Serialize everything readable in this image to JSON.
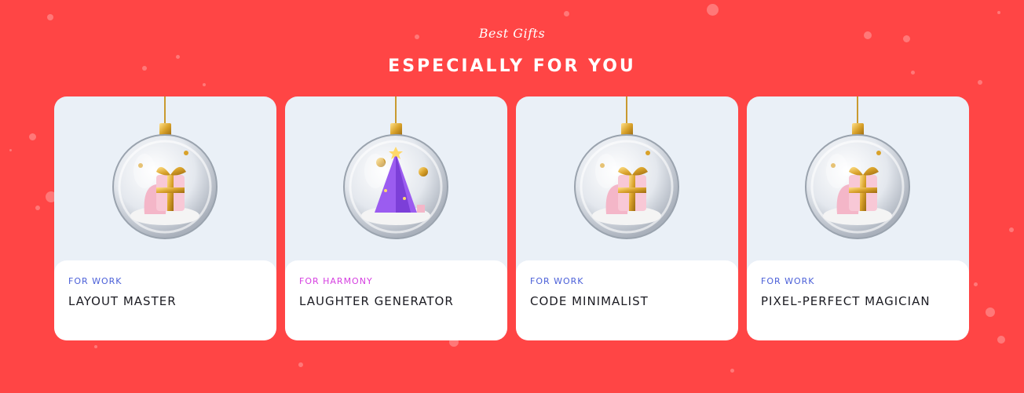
{
  "header": {
    "subtitle": "Best Gifts",
    "title": "ESPECIALLY FOR YOU"
  },
  "colors": {
    "background": "#ff4545",
    "card_bg": "#eaf0f7",
    "tag_work": "#4a5fd8",
    "tag_harmony": "#d53ee0"
  },
  "cards": [
    {
      "tag": "FOR WORK",
      "tag_color": "#4a5fd8",
      "name": "LAYOUT MASTER",
      "ornament": "gift-ornament"
    },
    {
      "tag": "FOR HARMONY",
      "tag_color": "#d53ee0",
      "name": "LAUGHTER GENERATOR",
      "ornament": "tree-ornament"
    },
    {
      "tag": "FOR WORK",
      "tag_color": "#4a5fd8",
      "name": "CODE MINIMALIST",
      "ornament": "gift-ornament"
    },
    {
      "tag": "FOR WORK",
      "tag_color": "#4a5fd8",
      "name": "PIXEL-PERFECT MAGICIAN",
      "ornament": "gift-ornament"
    }
  ]
}
